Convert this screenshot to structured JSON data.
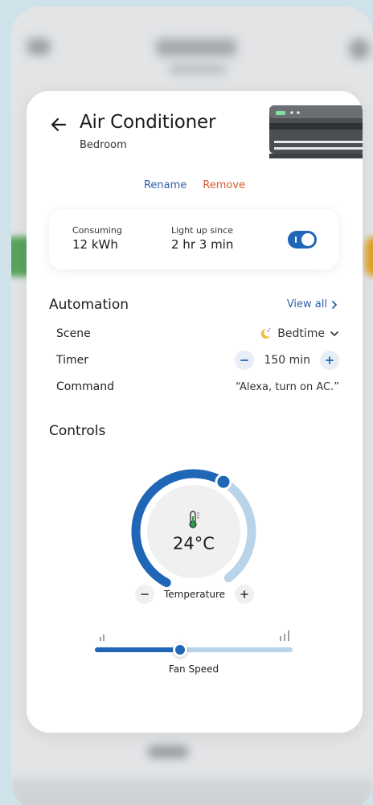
{
  "device": {
    "name": "Air Conditioner",
    "room": "Bedroom"
  },
  "actions": {
    "rename": "Rename",
    "remove": "Remove"
  },
  "stats": {
    "consuming_label": "Consuming",
    "consuming_value": "12 kWh",
    "light_label": "Light up since",
    "light_value": "2 hr 3 min",
    "power_on": true
  },
  "automation": {
    "title": "Automation",
    "view_all": "View all",
    "scene_label": "Scene",
    "scene_value": "Bedtime",
    "timer_label": "Timer",
    "timer_value": "150 min",
    "command_label": "Command",
    "command_value": "“Alexa, turn on AC.”"
  },
  "controls": {
    "title": "Controls",
    "temperature_value": "24°C",
    "temperature_label": "Temperature",
    "temperature_level": 0.62,
    "fan_label": "Fan Speed",
    "fan_level": 0.43
  },
  "colors": {
    "accent": "#1f66b6",
    "accent_light": "#b9d3e8",
    "link": "#2f5fa8",
    "danger": "#d85a2d",
    "scene_icon": "#f4b73a"
  }
}
